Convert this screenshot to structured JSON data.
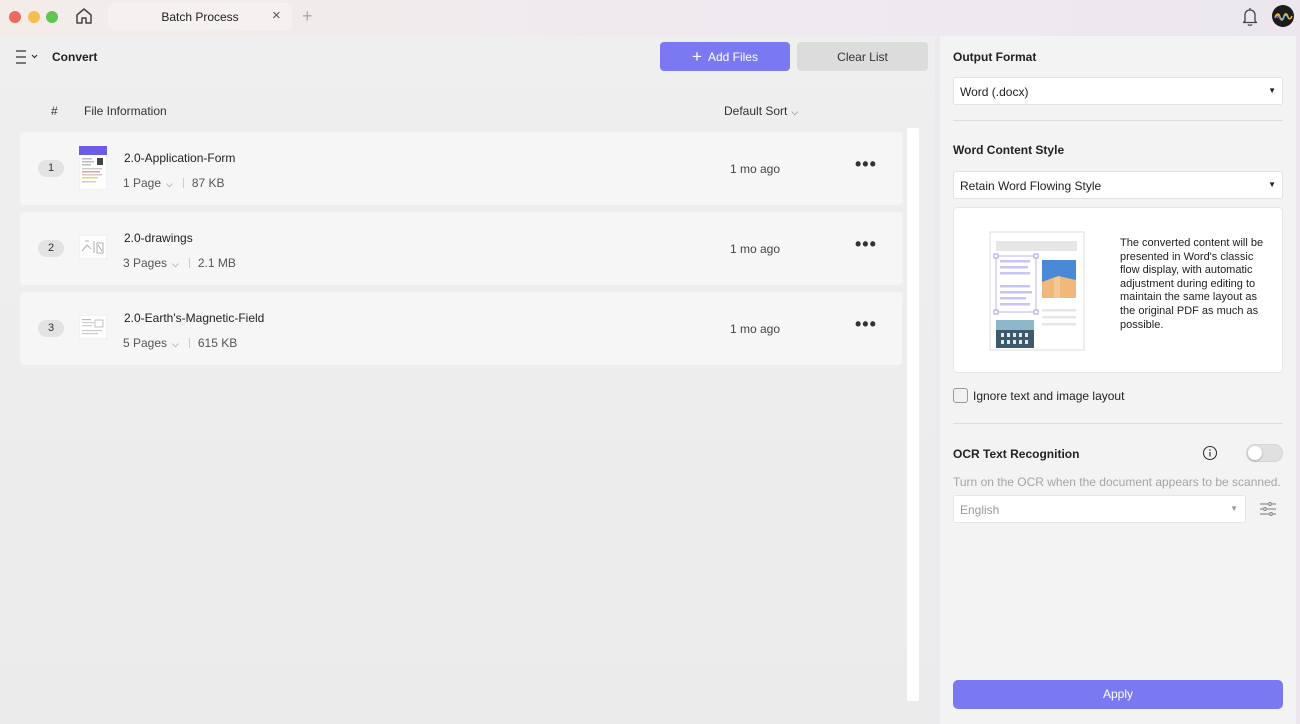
{
  "titlebar": {
    "tab_title": "Batch Process",
    "tab_close": "×",
    "tab_add": "+"
  },
  "toolbar": {
    "page_title": "Convert",
    "add_files_label": "Add Files",
    "clear_list_label": "Clear List"
  },
  "list": {
    "col_number": "#",
    "col_info": "File Information",
    "sort_label": "Default Sort",
    "files": [
      {
        "number": "1",
        "name": "2.0-Application-Form",
        "pages": "1 Page",
        "size": "87 KB",
        "time": "1 mo ago"
      },
      {
        "number": "2",
        "name": "2.0-drawings",
        "pages": "3 Pages",
        "size": "2.1 MB",
        "time": "1 mo ago"
      },
      {
        "number": "3",
        "name": "2.0-Earth's-Magnetic-Field",
        "pages": "5 Pages",
        "size": "615 KB",
        "time": "1 mo ago"
      }
    ],
    "more_label": "•••"
  },
  "side": {
    "output_format_title": "Output Format",
    "output_format_value": "Word (.docx)",
    "content_style_title": "Word Content Style",
    "content_style_value": "Retain Word Flowing Style",
    "style_description": "The converted content will be presented in Word's classic flow display, with automatic adjustment during editing to maintain the same layout as the original PDF as much as possible.",
    "ignore_layout_label": "Ignore text and image layout",
    "ignore_layout_checked": false,
    "ocr_title": "OCR Text Recognition",
    "ocr_enabled": false,
    "ocr_hint": "Turn on the OCR when the document appears to be scanned.",
    "ocr_language": "English",
    "apply_label": "Apply"
  },
  "colors": {
    "accent": "#7b79f2",
    "traffic_red": "#ed6a5e",
    "traffic_yellow": "#f5bf4f",
    "traffic_green": "#61c554"
  },
  "icons": [
    "home-icon",
    "bell-icon",
    "menu-icon",
    "plus-icon",
    "chevron-down-icon",
    "more-icon",
    "info-icon",
    "settings-sliders-icon"
  ]
}
